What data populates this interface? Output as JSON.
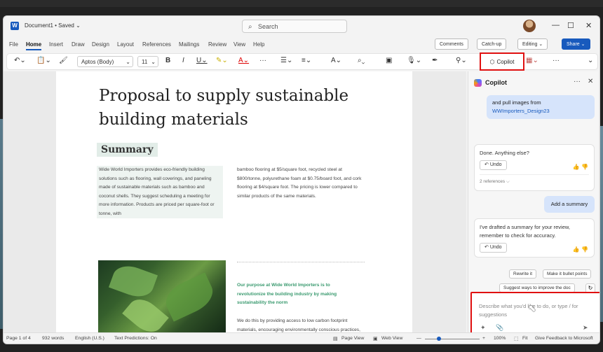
{
  "titlebar": {
    "doc_name": "Document1 • Saved ⌄",
    "search_placeholder": "Search"
  },
  "menu": [
    "File",
    "Home",
    "Insert",
    "Draw",
    "Design",
    "Layout",
    "References",
    "Mailings",
    "Review",
    "View",
    "Help"
  ],
  "actions": {
    "comments": "Comments",
    "catchup": "Catch-up",
    "editing": "Editing ⌄",
    "share": "Share ⌄"
  },
  "ribbon": {
    "font_name": "Aptos (Body)",
    "font_size": "11",
    "copilot": "Copilot"
  },
  "document": {
    "title": "Proposal to supply sustainable building materials",
    "summary_heading": "Summary",
    "col1": "Wide World Importers provides eco-friendly building solutions such as flooring, wall coverings, and paneling made of sustainable materials such as bamboo and coconut shells. They suggest scheduling a meeting for more information. Products are priced per square-foot or tonne, with",
    "col2": "bamboo flooring at $5/square foot, recycled steel at $800/tonne, polyurethane foam at $0.75/board foot, and cork flooring at $4/square foot. The pricing is lower compared to similar products of the same materials.",
    "purpose": "Our purpose at Wide World Importers is to revolutionize the building industry by making sustainability the norm",
    "purpose_body": "We do this by providing access to low carbon footprint materials, encouraging environmentally conscious practices, and reducing our clients' carbon footprint through the use of our sustainable"
  },
  "copilot": {
    "title": "Copilot",
    "user_msg1_text": "and pull images from",
    "user_msg1_link": "WWImporters_Design23",
    "ai_msg1": "Done. Anything else?",
    "undo": "Undo",
    "references": "2 references ⌵",
    "user_msg2": "Add a summary",
    "ai_msg2": "I've drafted a summary for your review, remember to check for accuracy.",
    "sugg_rewrite": "Rewrite it",
    "sugg_bullets": "Make it bullet points",
    "sugg_improve": "Suggest ways to improve the doc",
    "compose_placeholder": "Describe what you'd like to do, or type / for suggestions"
  },
  "status": {
    "page": "Page 1 of 4",
    "words": "932 words",
    "lang": "English (U.S.)",
    "predictions": "Text Predictions: On",
    "page_view": "Page View",
    "web_view": "Web View",
    "zoom": "100%",
    "fit": "Fit",
    "feedback": "Give Feedback to Microsoft"
  }
}
